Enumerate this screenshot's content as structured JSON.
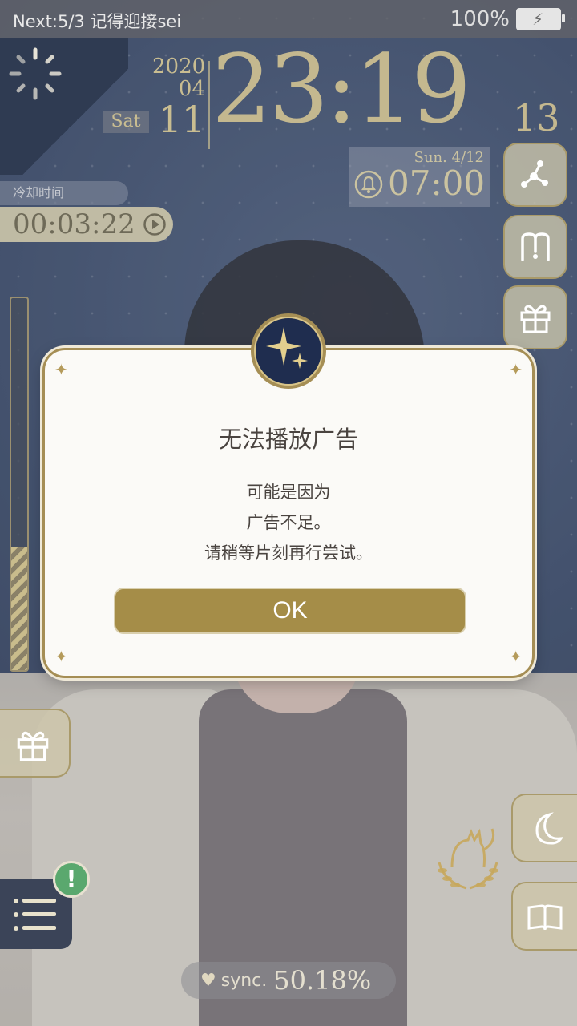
{
  "status_bar": {
    "left_text": "Next:5/3 记得迎接sei",
    "battery": "100%"
  },
  "clock": {
    "year": "2020",
    "month": "04",
    "day": "11",
    "weekday": "Sat",
    "time": "23:19",
    "seconds": "13"
  },
  "alarm": {
    "date": "Sun.  4/12",
    "time": "07:00"
  },
  "cooldown": {
    "label": "冷却时间",
    "timer": "00:03:22"
  },
  "sync": {
    "label": "sync.",
    "value": "50.18%"
  },
  "dialog": {
    "title": "无法播放广告",
    "lines": [
      "可能是因为",
      "广告不足。",
      "请稍等片刻再行尝试。"
    ],
    "ok_label": "OK"
  },
  "notice_badge": "!",
  "colors": {
    "accent_gold": "#a58d48",
    "frame_gold": "#a58e55",
    "navy": "#3b4458",
    "badge_green": "#5aa86e"
  },
  "icons": [
    "spinner-icon",
    "share-icon",
    "m-icon",
    "gift-icon",
    "moon-icon",
    "book-icon",
    "menu-icon",
    "cat-emblem-icon",
    "bell-icon",
    "play-icon",
    "star-emblem-icon"
  ]
}
